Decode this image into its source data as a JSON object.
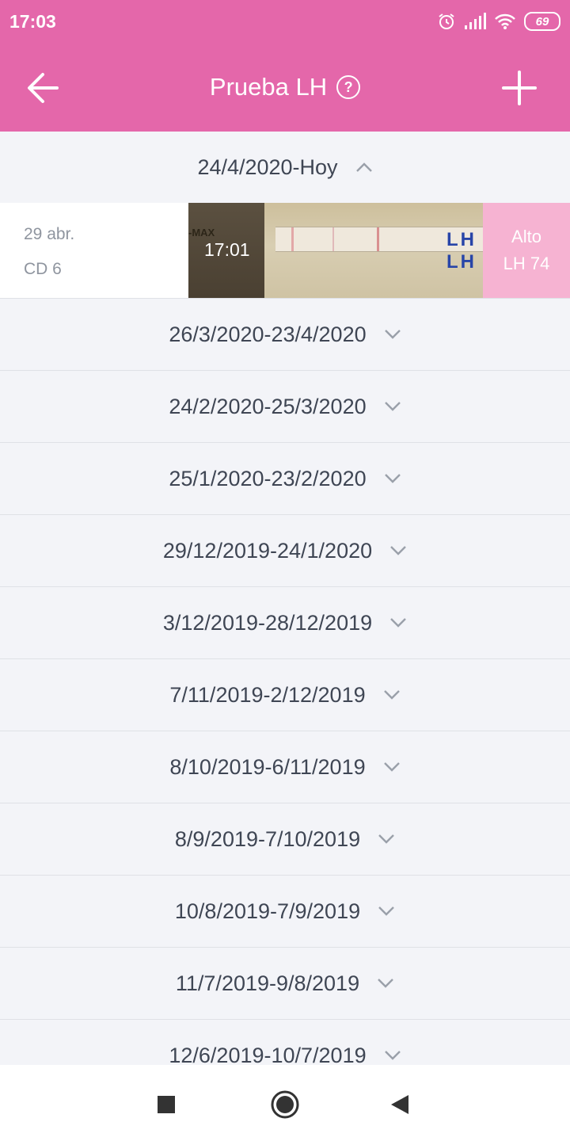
{
  "status_bar": {
    "time": "17:03",
    "battery": "69",
    "icons": [
      "alarm-icon",
      "signal-icon",
      "wifi-icon",
      "battery-icon"
    ]
  },
  "header": {
    "title": "Prueba LH",
    "back_icon": "arrow-left-icon",
    "help_icon": "question-circle-icon",
    "add_icon": "plus-icon",
    "background": "#e467aa"
  },
  "periods": [
    {
      "label": "24/4/2020-Hoy",
      "expanded": true
    },
    {
      "label": "26/3/2020-23/4/2020",
      "expanded": false
    },
    {
      "label": "24/2/2020-25/3/2020",
      "expanded": false
    },
    {
      "label": "25/1/2020-23/2/2020",
      "expanded": false
    },
    {
      "label": "29/12/2019-24/1/2020",
      "expanded": false
    },
    {
      "label": "3/12/2019-28/12/2019",
      "expanded": false
    },
    {
      "label": "7/11/2019-2/12/2019",
      "expanded": false
    },
    {
      "label": "8/10/2019-6/11/2019",
      "expanded": false
    },
    {
      "label": "8/9/2019-7/10/2019",
      "expanded": false
    },
    {
      "label": "10/8/2019-7/9/2019",
      "expanded": false
    },
    {
      "label": "11/7/2019-9/8/2019",
      "expanded": false
    },
    {
      "label": "12/6/2019-10/7/2019",
      "expanded": false
    }
  ],
  "entry": {
    "date": "29 abr.",
    "cycle_day": "CD 6",
    "time": "17:01",
    "result_level": "Alto",
    "result_value": "LH 74",
    "photo_brand_text": "-MAX",
    "photo_strip_text": "LH LH",
    "result_color": "#f6b3d2"
  },
  "nav": {
    "recent_icon": "square-icon",
    "home_icon": "circle-icon",
    "back_icon": "triangle-left-icon"
  }
}
